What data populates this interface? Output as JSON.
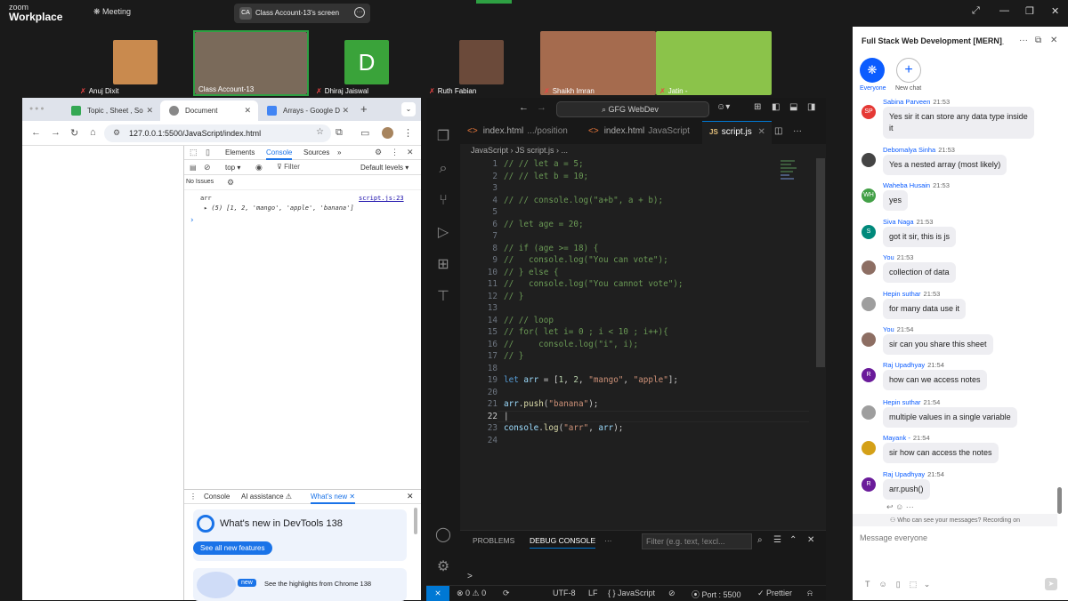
{
  "zoom": {
    "logo_small": "zoom",
    "logo_big": "Workplace",
    "meeting_label": "Meeting",
    "share_badge": "CA",
    "share_title": "Class Account-13's screen",
    "window_controls": [
      "⤢",
      "—",
      "❐",
      "✕"
    ]
  },
  "gallery": [
    {
      "name": "Anuj Dixit",
      "muted": true,
      "color": "#c98a4e"
    },
    {
      "name": "Class Account-13",
      "muted": false,
      "color": "#7a6a5a"
    },
    {
      "name": "Dhiraj Jaiswal",
      "muted": true,
      "color": "#3aa33a",
      "initial": "D"
    },
    {
      "name": "Ruth Fabian",
      "muted": true,
      "color": "#6b4a3a"
    },
    {
      "name": "Shaikh Imran",
      "muted": true,
      "color": "#a56b4e"
    },
    {
      "name": "Jatin -",
      "muted": true,
      "color": "#8bc34a"
    }
  ],
  "browser": {
    "tabs": [
      {
        "label": "Topic , Sheet , So",
        "icon_color": "#34a853"
      },
      {
        "label": "Document",
        "icon_color": "#888888"
      },
      {
        "label": "Arrays - Google D",
        "icon_color": "#4285f4"
      }
    ],
    "url": "127.0.0.1:5500/JavaScript/index.html",
    "devtools": {
      "tabs": [
        "Elements",
        "Console",
        "Sources",
        "»"
      ],
      "context": "top ▾",
      "filter_placeholder": "Filter",
      "levels": "Default levels ▾",
      "issues": "No Issues",
      "log_label": "arr",
      "log_source": "script.js:23",
      "log_value": "▸ (5) [1, 2, 'mango', 'apple', 'banana']",
      "prompt": "›",
      "drawer_tabs": [
        "Console",
        "AI assistance ⚠",
        "What's new ✕"
      ],
      "whats_new_title": "What's new in DevTools 138",
      "see_all_button": "See all new features",
      "highlights_badge": "new",
      "highlights_text": "See the highlights from Chrome 138"
    }
  },
  "vscode": {
    "search": "GFG WebDev",
    "tabs": [
      {
        "label": "index.html",
        "desc": ".../position"
      },
      {
        "label": "index.html",
        "desc": "JavaScript"
      },
      {
        "label": "script.js",
        "desc": ""
      }
    ],
    "breadcrumb": "JavaScript  ›  JS  script.js  ›  ...",
    "cursor_line": 22,
    "lines": [
      {
        "n": "1",
        "h": "<span class='cm'>// // let a = 5;</span>"
      },
      {
        "n": "2",
        "h": "<span class='cm'>// // let b = 10;</span>"
      },
      {
        "n": "3",
        "h": ""
      },
      {
        "n": "4",
        "h": "<span class='cm'>// // console.log(\"a+b\", a + b);</span>"
      },
      {
        "n": "5",
        "h": ""
      },
      {
        "n": "6",
        "h": "<span class='cm'>// let age = 20;</span>"
      },
      {
        "n": "7",
        "h": ""
      },
      {
        "n": "8",
        "h": "<span class='cm'>// if (age >= 18) {</span>"
      },
      {
        "n": "9",
        "h": "<span class='cm'>//   console.log(\"You can vote\");</span>"
      },
      {
        "n": "10",
        "h": "<span class='cm'>// } else {</span>"
      },
      {
        "n": "11",
        "h": "<span class='cm'>//   console.log(\"You cannot vote\");</span>"
      },
      {
        "n": "12",
        "h": "<span class='cm'>// }</span>"
      },
      {
        "n": "13",
        "h": ""
      },
      {
        "n": "14",
        "h": "<span class='cm'>// // loop</span>"
      },
      {
        "n": "15",
        "h": "<span class='cm'>// for( let i= 0 ; i &lt; 10 ; i++){</span>"
      },
      {
        "n": "16",
        "h": "<span class='cm'>//     console.log(\"i\", i);</span>"
      },
      {
        "n": "17",
        "h": "<span class='cm'>// }</span>"
      },
      {
        "n": "18",
        "h": ""
      },
      {
        "n": "19",
        "h": "<span class='kw'>let</span> <span class='vr'>arr</span> = [<span class='nu'>1</span>, <span class='nu'>2</span>, <span class='st'>\"mango\"</span>, <span class='st'>\"apple\"</span>];"
      },
      {
        "n": "20",
        "h": ""
      },
      {
        "n": "21",
        "h": "<span class='vr'>arr</span>.<span class='fn'>push</span>(<span class='st'>\"banana\"</span>);"
      },
      {
        "n": "22",
        "h": "|"
      },
      {
        "n": "23",
        "h": "<span class='vr'>console</span>.<span class='fn'>log</span>(<span class='st'>\"arr\"</span>, <span class='vr'>arr</span>);"
      },
      {
        "n": "24",
        "h": ""
      }
    ],
    "panel_tabs": [
      "PROBLEMS",
      "DEBUG CONSOLE",
      "···"
    ],
    "panel_filter": "Filter (e.g. text, !excl...",
    "panel_prompt": ">",
    "status": {
      "errors": "⊗ 0 ⚠ 0",
      "encoding": "UTF-8",
      "eol": "LF",
      "language": "{ }  JavaScript",
      "port": "Port : 5500",
      "prettier": "✓ Prettier"
    }
  },
  "chat": {
    "title": "Full Stack Web Development [MERN]_Wee...",
    "everyone_label": "Everyone",
    "new_chat_label": "New chat",
    "messages": [
      {
        "sender": "Sabina Parveen",
        "time": "21:53",
        "text": "Yes sir it can store any data type inside it",
        "initials": "SP",
        "color": "#e53935"
      },
      {
        "sender": "Debomalya Sinha",
        "time": "21:53",
        "text": "Yes a nested array (most likely)",
        "initials": "",
        "color": "#444444"
      },
      {
        "sender": "Waheba Husain",
        "time": "21:53",
        "text": "yes",
        "initials": "WH",
        "color": "#43a047"
      },
      {
        "sender": "Siva Naga",
        "time": "21:53",
        "text": "got it sir, this is js",
        "initials": "S",
        "color": "#00897b"
      },
      {
        "sender": "You",
        "time": "21:53",
        "text": "collection of data",
        "initials": "",
        "color": "#8d6e63"
      },
      {
        "sender": "Hepin suthar",
        "time": "21:53",
        "text": "for many data use it",
        "initials": "",
        "color": "#9e9e9e"
      },
      {
        "sender": "You",
        "time": "21:54",
        "text": "sir can you share this sheet",
        "initials": "",
        "color": "#8d6e63"
      },
      {
        "sender": "Raj Upadhyay",
        "time": "21:54",
        "text": "how can we access notes",
        "initials": "R",
        "color": "#6a1b9a"
      },
      {
        "sender": "Hepin suthar",
        "time": "21:54",
        "text": "multiple values in a single variable",
        "initials": "",
        "color": "#9e9e9e"
      },
      {
        "sender": "Mayank -",
        "time": "21:54",
        "text": "sir how can access the notes",
        "initials": "",
        "color": "#d4a017"
      },
      {
        "sender": "Raj Upadhyay",
        "time": "21:54",
        "text": "arr.push()",
        "initials": "R",
        "color": "#6a1b9a"
      }
    ],
    "recording_note": "Who can see your messages? Recording on",
    "input_placeholder": "Message everyone"
  }
}
